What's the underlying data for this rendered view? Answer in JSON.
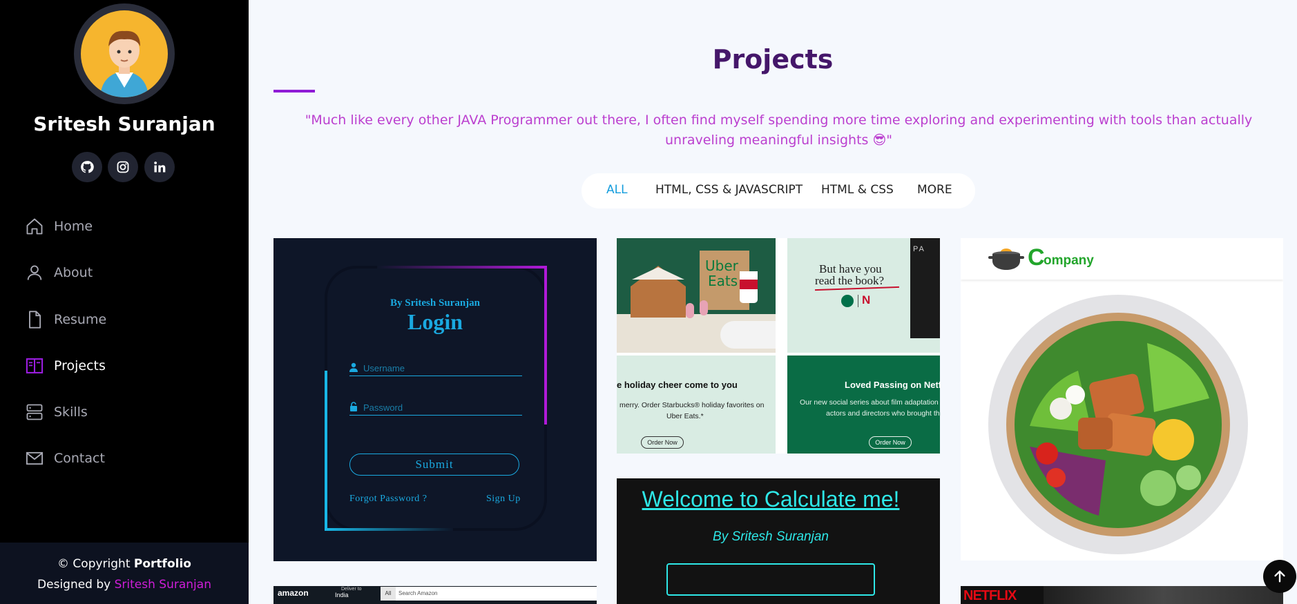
{
  "profile": {
    "name": "Sritesh Suranjan"
  },
  "social": [
    {
      "name": "github-icon"
    },
    {
      "name": "instagram-icon"
    },
    {
      "name": "linkedin-icon"
    }
  ],
  "nav": {
    "items": [
      {
        "label": "Home",
        "icon": "home-icon"
      },
      {
        "label": "About",
        "icon": "user-icon"
      },
      {
        "label": "Resume",
        "icon": "file-icon"
      },
      {
        "label": "Projects",
        "icon": "book-icon",
        "active": true
      },
      {
        "label": "Skills",
        "icon": "server-icon"
      },
      {
        "label": "Contact",
        "icon": "envelope-icon"
      }
    ]
  },
  "footer": {
    "copyright_prefix": "© Copyright ",
    "copyright_brand": "Portfolio",
    "designed_prefix": "Designed by ",
    "designed_name": "Sritesh Suranjan"
  },
  "main": {
    "title": "Projects",
    "quote": "\"Much like every other JAVA Programmer out there, I often find myself spending more time exploring and experimenting with tools than actually unraveling meaningful insights 😎\""
  },
  "filters": [
    {
      "label": "ALL",
      "active": true
    },
    {
      "label": "HTML, CSS & JAVASCRIPT"
    },
    {
      "label": "HTML & CSS"
    },
    {
      "label": "MORE"
    }
  ],
  "cards": {
    "login": {
      "by": "By Sritesh Suranjan",
      "title": "Login",
      "username_placeholder": "Username",
      "password_placeholder": "Password",
      "submit": "Submit",
      "forgot": "Forgot Password ?",
      "signup": "Sign Up"
    },
    "starbucks": {
      "uber": "Uber",
      "eats": "Eats",
      "book_line1": "But have you",
      "book_line2": "read the book?",
      "pa": "PA",
      "holiday_title": "e holiday cheer come to you",
      "holiday_text1": "merry. Order Starbucks® holiday favorites on",
      "holiday_text2": "Uber Eats.*",
      "order1": "Order Now",
      "netflix_title": "Loved Passing on Netf",
      "netflix_text1": "Our new social series about film adaptation",
      "netflix_text2": "actors and directors who brought the",
      "order2": "Order Now"
    },
    "calc": {
      "title": "Welcome to Calculate me!",
      "by": "By Sritesh Suranjan"
    },
    "food": {
      "brand_c": "C",
      "brand_rest": "ompany"
    },
    "amazon": {
      "logo": "amazon",
      "deliver": "Deliver to",
      "country": "India",
      "all": "All",
      "search": "Search Amazon"
    },
    "netflix": {
      "logo": "NETFLIX"
    }
  },
  "colors": {
    "sidebar_bg": "#000000",
    "accent_purple": "#cf1dd9",
    "title_color": "#45176a",
    "quote_color": "#bb3fcf",
    "filter_active": "#149ddd"
  }
}
